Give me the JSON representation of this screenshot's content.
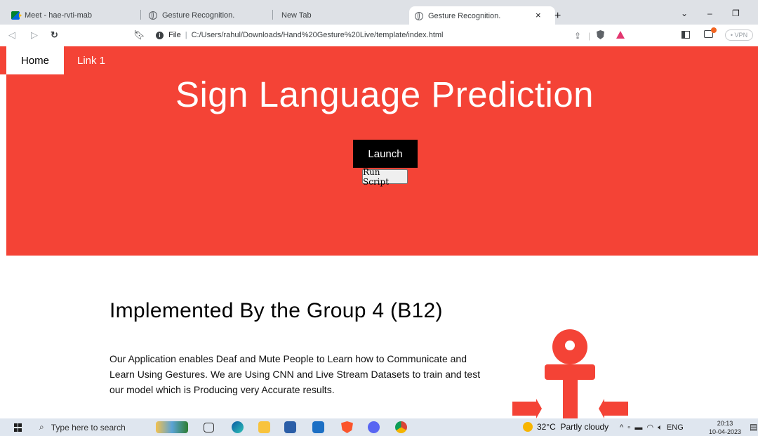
{
  "browser": {
    "tabs": [
      {
        "label": "Meet - hae-rvti-mab",
        "icon": "google-meet-icon"
      },
      {
        "label": "Gesture Recognition.",
        "icon": "globe-icon"
      },
      {
        "label": "New Tab",
        "icon": ""
      },
      {
        "label": "Gesture Recognition.",
        "icon": "globe-icon",
        "active": true
      }
    ],
    "tab_close": "×",
    "new_tab": "+",
    "window_controls": {
      "dropdown": "⌄",
      "minimize": "–",
      "restore": "❐"
    },
    "address": {
      "scheme_label": "File",
      "url": "C:/Users/rahul/Downloads/Hand%20Gesture%20Live/template/index.html"
    },
    "vpn_label": "• VPN"
  },
  "site": {
    "nav": {
      "home": "Home",
      "link1": "Link 1"
    },
    "hero": {
      "title": "Sign Language Prediction",
      "launch_label": "Launch",
      "run_script_label": "Run Script",
      "color": "#f44336"
    },
    "section": {
      "title": "Implemented By the Group 4 (B12)",
      "text": "Our Application enables Deaf and Mute People to Learn how to Communicate and Learn Using Gestures. We are Using CNN and Live Stream Datasets to train and test our model which is Producing very Accurate results.",
      "icon": "anchor-icon"
    }
  },
  "taskbar": {
    "search_placeholder": "Type here to search",
    "weather": {
      "temp": "32°C",
      "desc": "Partly cloudy"
    },
    "tray_lang": "ENG",
    "time": "20:13",
    "date": "10-04-2023"
  }
}
